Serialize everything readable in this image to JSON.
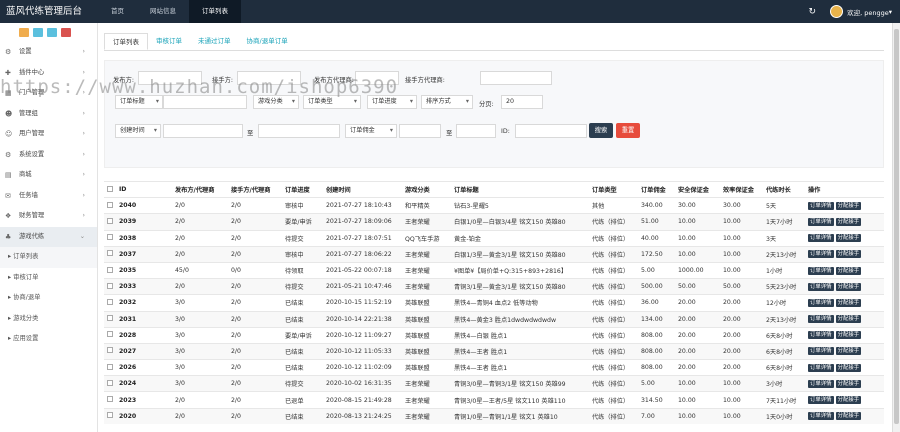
{
  "app": {
    "title": "蓝风代练管理后台",
    "user": "欢迎, pengge"
  },
  "topnav": [
    "首页",
    "网站信息",
    "订单列表"
  ],
  "quick_colors": [
    "#f0ad4e",
    "#5bc0de",
    "#5bc0de",
    "#d9534f"
  ],
  "menu": [
    {
      "label": "设置",
      "icon": "gear-icon",
      "glyph": "⚙"
    },
    {
      "label": "插件中心",
      "icon": "puzzle-icon",
      "glyph": "✚"
    },
    {
      "label": "门户管理",
      "icon": "grid-icon",
      "glyph": "▦"
    },
    {
      "label": "管理组",
      "icon": "user-group-icon",
      "glyph": "☻"
    },
    {
      "label": "用户管理",
      "icon": "user-icon",
      "glyph": "☺"
    },
    {
      "label": "系统设置",
      "icon": "settings-icon",
      "glyph": "⚙"
    },
    {
      "label": "商城",
      "icon": "cart-icon",
      "glyph": "▤"
    },
    {
      "label": "任务墙",
      "icon": "task-icon",
      "glyph": "✉"
    },
    {
      "label": "财务管理",
      "icon": "finance-icon",
      "glyph": "❖"
    },
    {
      "label": "游戏代练",
      "icon": "gamepad-icon",
      "glyph": "♣"
    }
  ],
  "submenu": [
    "订单列表",
    "审核订单",
    "协商/退单",
    "游戏分类",
    "应用设置"
  ],
  "tabs": [
    "订单列表",
    "审核订单",
    "未通过订单",
    "协商/退单订单"
  ],
  "filter": {
    "publisher_label": "发布方:",
    "taker_label": "接手方:",
    "publisher_agent_label": "发布方代理商:",
    "taker_agent_label": "接手方代理商:",
    "title_select": "订单标题",
    "category_select": "游戏分类",
    "type_select": "订单类型",
    "progress_select": "订单进度",
    "sort_select": "排序方式",
    "page_label": "分页:",
    "page_value": "20",
    "time_select": "创建时间",
    "to1": "至",
    "price_select": "订单佣金",
    "to2": "至",
    "id_label": "ID:",
    "search_btn": "搜索",
    "reset_btn": "重置"
  },
  "watermark": "https://www.huzhan.com/ishop6390",
  "table": {
    "headers": [
      "ID",
      "发布方/代理商",
      "接手方/代理商",
      "订单进度",
      "创建时间",
      "游戏分类",
      "订单标题",
      "订单类型",
      "订单佣金",
      "安全保证金",
      "效率保证金",
      "代练时长",
      "操作"
    ],
    "action1": "订单详情",
    "action2": "分配接手",
    "rows": [
      [
        "2040",
        "2/0",
        "2/0",
        "审核中",
        "2021-07-27 18:10:43",
        "和平精英",
        "钻石3-星耀5",
        "其他",
        "340.00",
        "30.00",
        "30.00",
        "5天"
      ],
      [
        "2039",
        "2/0",
        "2/0",
        "要单/申诉",
        "2021-07-27 18:09:06",
        "王者荣耀",
        "白银1/0星—白银3/4星 铭文150 英雄80",
        "代练（排位）",
        "51.00",
        "10.00",
        "10.00",
        "1天7小时"
      ],
      [
        "2038",
        "2/0",
        "2/0",
        "待提交",
        "2021-07-27 18:07:51",
        "QQ飞车手游",
        "黄金-铂金",
        "代练（排位）",
        "40.00",
        "10.00",
        "10.00",
        "3天"
      ],
      [
        "2037",
        "2/0",
        "2/0",
        "审核中",
        "2021-07-27 18:06:22",
        "王者荣耀",
        "白银1/3星—黄金3/1星 铭文150 英雄80",
        "代练（排位）",
        "172.50",
        "10.00",
        "10.00",
        "2天13小时"
      ],
      [
        "2035",
        "45/0",
        "0/0",
        "待领取",
        "2021-05-22 00:07:18",
        "王者荣耀",
        "¥图单¥【局价单+Q:315+893+2816】",
        "代练（排位）",
        "5.00",
        "1000.00",
        "10.00",
        "1小时"
      ],
      [
        "2033",
        "2/0",
        "2/0",
        "待提交",
        "2021-05-21 10:47:46",
        "王者荣耀",
        "青铜3/1星—黄金3/1星 铭文150 英雄80",
        "代练（排位）",
        "500.00",
        "50.00",
        "50.00",
        "5天23小时"
      ],
      [
        "2032",
        "3/0",
        "2/0",
        "已结束",
        "2020-10-15 11:52:19",
        "英雄联盟",
        "黑铁4—青铜4 血点2 低等动物",
        "代练（排位）",
        "36.00",
        "20.00",
        "20.00",
        "12小时"
      ],
      [
        "2031",
        "3/0",
        "2/0",
        "已结束",
        "2020-10-14 22:21:38",
        "英雄联盟",
        "黑铁4—黄金3 胜点1dwdwdwdwdw",
        "代练（排位）",
        "134.00",
        "20.00",
        "20.00",
        "2天13小时"
      ],
      [
        "2028",
        "3/0",
        "2/0",
        "要单/申诉",
        "2020-10-12 11:09:27",
        "英雄联盟",
        "黑铁4—白银 胜点1",
        "代练（排位）",
        "808.00",
        "20.00",
        "20.00",
        "6天8小时"
      ],
      [
        "2027",
        "3/0",
        "2/0",
        "已结束",
        "2020-10-12 11:05:33",
        "英雄联盟",
        "黑铁4—王者 胜点1",
        "代练（排位）",
        "808.00",
        "20.00",
        "20.00",
        "6天8小时"
      ],
      [
        "2026",
        "3/0",
        "2/0",
        "已结束",
        "2020-10-12 11:02:09",
        "英雄联盟",
        "黑铁4—王者 胜点1",
        "代练（排位）",
        "808.00",
        "20.00",
        "20.00",
        "6天8小时"
      ],
      [
        "2024",
        "3/0",
        "2/0",
        "待提交",
        "2020-10-02 16:31:35",
        "王者荣耀",
        "青铜3/0星—青铜3/1星 铭文150 英雄99",
        "代练（排位）",
        "5.00",
        "10.00",
        "10.00",
        "3小时"
      ],
      [
        "2023",
        "2/0",
        "2/0",
        "已退单",
        "2020-08-15 21:49:28",
        "王者荣耀",
        "青铜3/0星—王者/5星 铭文110 英雄110",
        "代练（排位）",
        "314.50",
        "10.00",
        "10.00",
        "7天11小时"
      ],
      [
        "2020",
        "2/0",
        "2/0",
        "已结束",
        "2020-08-13 21:24:25",
        "王者荣耀",
        "青铜1/0星—青铜1/1星 铭文1 英雄10",
        "代练（排位）",
        "7.00",
        "10.00",
        "10.00",
        "1天0小时"
      ]
    ]
  }
}
